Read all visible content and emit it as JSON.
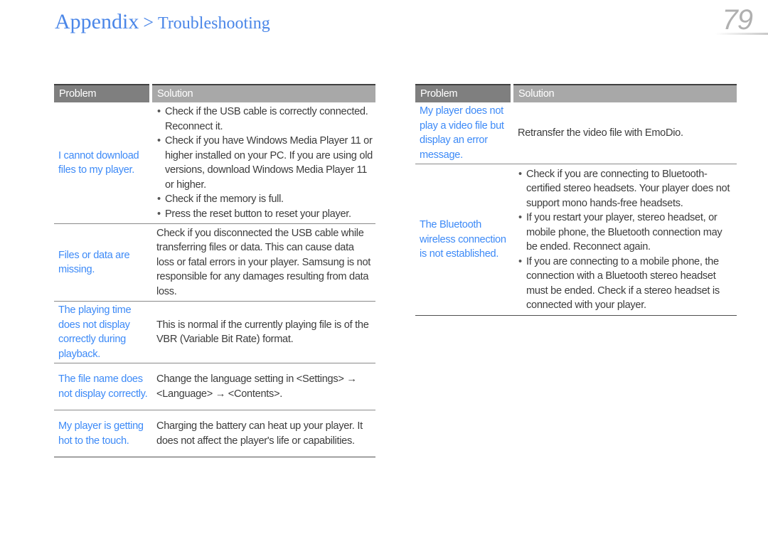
{
  "header": {
    "section": "Appendix",
    "separator": ">",
    "subsection": "Troubleshooting",
    "page_number": "79"
  },
  "left_table": {
    "headers": {
      "problem": "Problem",
      "solution": "Solution"
    },
    "rows": [
      {
        "problem": "I cannot download files to my player.",
        "bullets": [
          "Check if the USB cable is correctly connected. Reconnect it.",
          "Check if you have Windows Media Player 11 or higher installed on your PC. If you are using old versions, download Windows Media Player 11 or higher.",
          "Check if the memory is full.",
          "Press the reset button to reset your player."
        ]
      },
      {
        "problem": "Files or data are missing.",
        "solution": "Check if you disconnected the USB cable while transferring files or data. This can cause data loss or fatal errors in your player. Samsung is not responsible for any damages resulting from data loss."
      },
      {
        "problem": "The playing time does not display correctly during playback.",
        "solution": "This is normal if the currently playing file is of the VBR (Variable Bit Rate) format."
      },
      {
        "problem": "The file name does not display correctly.",
        "solution": "Change the language setting in <Settings> → <Language> → <Contents>."
      },
      {
        "problem": "My player is getting hot to the touch.",
        "solution": "Charging the battery can heat up your player. It does not affect the player's life or capabilities."
      }
    ]
  },
  "right_table": {
    "headers": {
      "problem": "Problem",
      "solution": "Solution"
    },
    "rows": [
      {
        "problem": "My player does not play a video file but display an error message.",
        "solution": "Retransfer the video file with EmoDio."
      },
      {
        "problem": "The Bluetooth wireless connection is not established.",
        "bullets": [
          "Check if you are connecting to Bluetooth-certified stereo headsets. Your player does not support mono hands-free headsets.",
          "If you restart your player, stereo headset, or mobile phone, the Bluetooth connection may be ended. Reconnect again.",
          "If you are connecting to a mobile phone, the connection with a Bluetooth stereo headset must be ended. Check if a stereo headset is connected with your player."
        ]
      }
    ]
  }
}
